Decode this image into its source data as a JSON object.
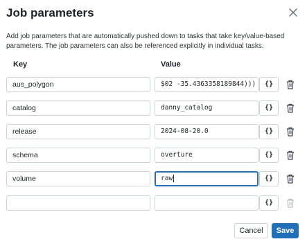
{
  "dialog": {
    "title": "Job parameters",
    "description": "Add job parameters that are automatically pushed down to tasks that take key/value-based parameters. The job parameters can also be referenced explicitly in individual tasks.",
    "columns": {
      "key": "Key",
      "value": "Value"
    },
    "dynamic_value_label": "{}",
    "rows": [
      {
        "key": "aus_polygon",
        "value": "$02 -35.4363358189844)))"
      },
      {
        "key": "catalog",
        "value": "danny_catalog"
      },
      {
        "key": "release",
        "value": "2024-08-20.0"
      },
      {
        "key": "schema",
        "value": "overture"
      },
      {
        "key": "volume",
        "value": "raw"
      },
      {
        "key": "",
        "value": ""
      }
    ],
    "cancel_label": "Cancel",
    "save_label": "Save",
    "accent_color": "#2270b8"
  }
}
